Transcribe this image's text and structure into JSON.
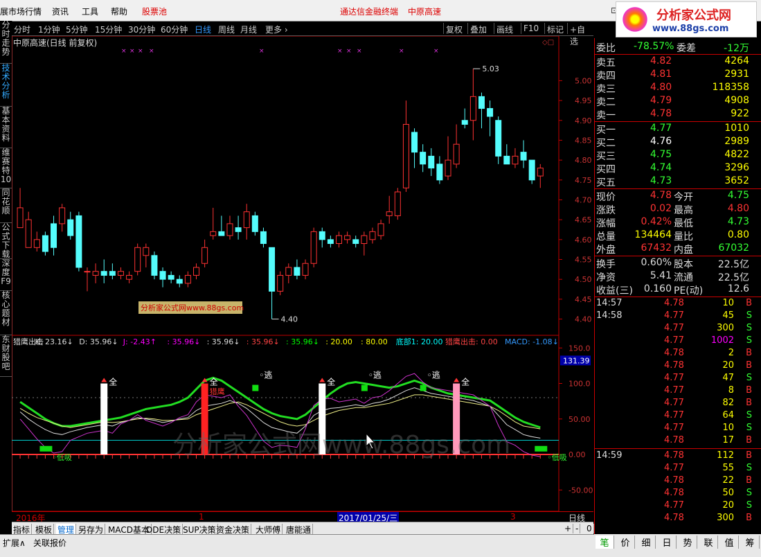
{
  "menu": {
    "items": [
      "展市场行情",
      "资讯",
      "工具",
      "帮助",
      "股票池"
    ],
    "center_title": "通达信金融终端",
    "center_stock": "中原高速"
  },
  "logo": {
    "title": "分析家公式网",
    "url": "www.88gs.com"
  },
  "left_tabs": [
    "分时走势",
    "技术分析",
    "基本资料",
    "维赛特10",
    "同花顺",
    "公式下载",
    "深度F9",
    "核心题材",
    "东财股吧"
  ],
  "timeframes": {
    "items": [
      "分时",
      "1分钟",
      "5分钟",
      "15分钟",
      "30分钟",
      "60分钟",
      "日线",
      "周线",
      "月线",
      "更多 ›"
    ],
    "selected": "日线",
    "right_items": [
      "复权",
      "叠加",
      "画线",
      "F10",
      "标记",
      "+自选"
    ]
  },
  "chart": {
    "title": "中原高速(日线 前复权)",
    "high_label": "5.03",
    "low_label": "4.40",
    "price_ticks": [
      "5.00",
      "4.95",
      "4.90",
      "4.85",
      "4.80",
      "4.75",
      "4.70",
      "4.65",
      "4.60",
      "4.55",
      "4.50",
      "4.45",
      "4.40"
    ],
    "watermark_box": "分析家公式网www.88gs.com",
    "watermark_big": "分析家公式网www.88gs.com",
    "indicator_header": [
      {
        "t": "猎鹰出击",
        "c": "#ddd"
      },
      {
        "t": "K: 23.16↓",
        "c": "#ddd"
      },
      {
        "t": "D: 35.96↓",
        "c": "#ddd"
      },
      {
        "t": "J: -2.43↑",
        "c": "#f0f"
      },
      {
        "t": ": 35.96↓",
        "c": "#f0f"
      },
      {
        "t": ": 35.96↓",
        "c": "#ddd"
      },
      {
        "t": ": 35.96↓",
        "c": "#f44"
      },
      {
        "t": ": 35.96↓",
        "c": "#0f0"
      },
      {
        "t": ": 20.00",
        "c": "#ff0"
      },
      {
        "t": ": 80.00",
        "c": "#ff0"
      },
      {
        "t": "底部1: 20.00",
        "c": "#0ff"
      }
    ],
    "indicator_header_right": {
      "a": "猎鹰出击: 0.00",
      "b": "MACD: -1.08↓"
    },
    "indicator_value_badge": "131.39",
    "ind_ticks": [
      "150.0",
      "100.0",
      "50.00",
      "0.00",
      "-50.00"
    ],
    "labels": {
      "quan": "全",
      "tao": "逃",
      "dixi": "低吸",
      "liechu": "猎鹰"
    },
    "dates": {
      "start": "2016年",
      "m1": "1",
      "current": "2017/01/25/三",
      "m3": "3",
      "period": "日线"
    }
  },
  "chart_data": {
    "type": "candlestick",
    "title": "中原高速(日线 前复权)",
    "ylim": [
      4.38,
      5.06
    ],
    "candles": [
      [
        4.63,
        4.68,
        4.66,
        4.73
      ],
      [
        4.58,
        4.65,
        4.6,
        4.67
      ],
      [
        4.58,
        4.6,
        4.57,
        4.62
      ],
      [
        4.61,
        4.57,
        4.56,
        4.62
      ],
      [
        4.64,
        4.58,
        4.56,
        4.66
      ],
      [
        4.64,
        4.68,
        4.62,
        4.69
      ],
      [
        4.65,
        4.61,
        4.6,
        4.67
      ],
      [
        4.66,
        4.53,
        4.52,
        4.67
      ],
      [
        4.52,
        4.52,
        4.47,
        4.53
      ],
      [
        4.51,
        4.52,
        4.49,
        4.54
      ],
      [
        4.52,
        4.51,
        4.49,
        4.55
      ],
      [
        4.52,
        4.51,
        4.5,
        4.54
      ],
      [
        4.51,
        4.52,
        4.5,
        4.53
      ],
      [
        4.5,
        4.51,
        4.49,
        4.52
      ],
      [
        4.52,
        4.58,
        4.51,
        4.59
      ],
      [
        4.56,
        4.58,
        4.53,
        4.59
      ],
      [
        4.56,
        4.51,
        4.5,
        4.57
      ],
      [
        4.52,
        4.5,
        4.48,
        4.53
      ],
      [
        4.51,
        4.5,
        4.49,
        4.52
      ],
      [
        4.5,
        4.49,
        4.48,
        4.51
      ],
      [
        4.49,
        4.51,
        4.48,
        4.52
      ],
      [
        4.51,
        4.53,
        4.5,
        4.54
      ],
      [
        4.54,
        4.58,
        4.53,
        4.6
      ],
      [
        4.61,
        4.62,
        4.6,
        4.68
      ],
      [
        4.62,
        4.61,
        4.61,
        4.66
      ],
      [
        4.61,
        4.64,
        4.6,
        4.66
      ],
      [
        4.63,
        4.62,
        4.6,
        4.66
      ],
      [
        4.63,
        4.67,
        4.6,
        4.69
      ],
      [
        4.66,
        4.62,
        4.61,
        4.67
      ],
      [
        4.62,
        4.59,
        4.58,
        4.63
      ],
      [
        4.58,
        4.47,
        4.4,
        4.58
      ],
      [
        4.47,
        4.51,
        4.46,
        4.52
      ],
      [
        4.51,
        4.53,
        4.49,
        4.54
      ],
      [
        4.53,
        4.51,
        4.5,
        4.55
      ],
      [
        4.51,
        4.54,
        4.5,
        4.55
      ],
      [
        4.54,
        4.62,
        4.53,
        4.63
      ],
      [
        4.62,
        4.6,
        4.58,
        4.63
      ],
      [
        4.6,
        4.59,
        4.58,
        4.61
      ],
      [
        4.59,
        4.61,
        4.58,
        4.62
      ],
      [
        4.6,
        4.61,
        4.59,
        4.62
      ],
      [
        4.6,
        4.59,
        4.58,
        4.61
      ],
      [
        4.59,
        4.61,
        4.56,
        4.62
      ],
      [
        4.6,
        4.62,
        4.59,
        4.63
      ],
      [
        4.61,
        4.64,
        4.6,
        4.65
      ],
      [
        4.66,
        4.67,
        4.64,
        4.71
      ],
      [
        4.66,
        4.72,
        4.65,
        4.73
      ],
      [
        4.73,
        4.89,
        4.72,
        4.95
      ],
      [
        4.87,
        4.82,
        4.78,
        4.88
      ],
      [
        4.82,
        4.79,
        4.77,
        4.84
      ],
      [
        4.81,
        4.78,
        4.76,
        4.83
      ],
      [
        4.79,
        4.75,
        4.74,
        4.81
      ],
      [
        4.76,
        4.8,
        4.75,
        4.86
      ],
      [
        4.79,
        4.84,
        4.78,
        4.89
      ],
      [
        4.9,
        4.89,
        4.88,
        4.93
      ],
      [
        4.9,
        4.96,
        4.85,
        5.03
      ],
      [
        4.96,
        4.93,
        4.88,
        4.97
      ],
      [
        4.93,
        4.91,
        4.86,
        4.95
      ],
      [
        4.9,
        4.81,
        4.79,
        4.91
      ],
      [
        4.81,
        4.79,
        4.79,
        4.84
      ],
      [
        4.79,
        4.81,
        4.78,
        4.83
      ],
      [
        4.82,
        4.8,
        4.78,
        4.85
      ],
      [
        4.8,
        4.75,
        4.74,
        4.8
      ],
      [
        4.76,
        4.78,
        4.73,
        4.79
      ]
    ],
    "indicator": {
      "name": "猎鹰出击",
      "ylim": [
        -80,
        160
      ],
      "signals_full": [
        10,
        22,
        36,
        52
      ],
      "signals_escape": [
        28,
        41,
        48
      ]
    }
  },
  "quote": {
    "weibi": {
      "label": "委比",
      "value": "-78.57%",
      "label2": "委差",
      "value2": "-12万"
    },
    "asks": [
      {
        "label": "卖五",
        "price": "4.82",
        "vol": "4264"
      },
      {
        "label": "卖四",
        "price": "4.81",
        "vol": "2931"
      },
      {
        "label": "卖三",
        "price": "4.80",
        "vol": "118358"
      },
      {
        "label": "卖二",
        "price": "4.79",
        "vol": "4908"
      },
      {
        "label": "卖一",
        "price": "4.78",
        "vol": "922"
      }
    ],
    "bids": [
      {
        "label": "买一",
        "price": "4.77",
        "vol": "1010",
        "pc": "#3f3"
      },
      {
        "label": "买二",
        "price": "4.76",
        "vol": "2989",
        "pc": "#fff"
      },
      {
        "label": "买三",
        "price": "4.75",
        "vol": "4822",
        "pc": "#3f3"
      },
      {
        "label": "买四",
        "price": "4.74",
        "vol": "3296",
        "pc": "#3f3"
      },
      {
        "label": "买五",
        "price": "4.73",
        "vol": "3652",
        "pc": "#3f3"
      }
    ],
    "stats": [
      {
        "l1": "现价",
        "v1": "4.78",
        "c1": "#f33",
        "l2": "今开",
        "v2": "4.75",
        "c2": "#3f3"
      },
      {
        "l1": "涨跌",
        "v1": "0.02",
        "c1": "#f33",
        "l2": "最高",
        "v2": "4.80",
        "c2": "#f33"
      },
      {
        "l1": "涨幅",
        "v1": "0.42%",
        "c1": "#f33",
        "l2": "最低",
        "v2": "4.73",
        "c2": "#3f3"
      },
      {
        "l1": "总量",
        "v1": "134464",
        "c1": "#ff0",
        "l2": "量比",
        "v2": "0.80",
        "c2": "#ff0"
      },
      {
        "l1": "外盘",
        "v1": "67432",
        "c1": "#f33",
        "l2": "内盘",
        "v2": "67032",
        "c2": "#3f3"
      }
    ],
    "stats2": [
      {
        "l1": "换手",
        "v1": "0.60%",
        "l2": "股本",
        "v2": "22.5亿"
      },
      {
        "l1": "净资",
        "v1": "5.41",
        "l2": "流通",
        "v2": "22.5亿"
      },
      {
        "l1": "收益(三)",
        "v1": "0.160",
        "l2": "PE(动)",
        "v2": "12.6"
      }
    ],
    "ticks": [
      {
        "time": "14:57",
        "price": "4.78",
        "vol": "10",
        "bs": "B"
      },
      {
        "time": "14:58",
        "price": "4.77",
        "vol": "45",
        "bs": "S"
      },
      {
        "time": "",
        "price": "4.77",
        "vol": "300",
        "bs": "S"
      },
      {
        "time": "",
        "price": "4.77",
        "vol": "1002",
        "bs": "S"
      },
      {
        "time": "",
        "price": "4.78",
        "vol": "2",
        "bs": "B"
      },
      {
        "time": "",
        "price": "4.78",
        "vol": "20",
        "bs": "B"
      },
      {
        "time": "",
        "price": "4.77",
        "vol": "47",
        "bs": "S"
      },
      {
        "time": "",
        "price": "4.77",
        "vol": "8",
        "bs": "B"
      },
      {
        "time": "",
        "price": "4.77",
        "vol": "82",
        "bs": "B"
      },
      {
        "time": "",
        "price": "4.77",
        "vol": "64",
        "bs": "S"
      },
      {
        "time": "",
        "price": "4.77",
        "vol": "10",
        "bs": "S"
      },
      {
        "time": "",
        "price": "4.78",
        "vol": "17",
        "bs": "B"
      },
      {
        "time": "14:59",
        "price": "4.78",
        "vol": "112",
        "bs": "B"
      },
      {
        "time": "",
        "price": "4.77",
        "vol": "55",
        "bs": "S"
      },
      {
        "time": "",
        "price": "4.78",
        "vol": "22",
        "bs": "B"
      },
      {
        "time": "",
        "price": "4.78",
        "vol": "50",
        "bs": "S"
      },
      {
        "time": "",
        "price": "4.77",
        "vol": "20",
        "bs": "S"
      },
      {
        "time": "",
        "price": "4.78",
        "vol": "300",
        "bs": "B"
      }
    ]
  },
  "bottom_tabs": [
    "指标",
    "模板",
    "管理",
    "另存为",
    "MACD基本",
    "DDE决策",
    "SUP决策",
    "资金决策",
    "大师傅",
    "唐能通"
  ],
  "bottom_selected": "管理",
  "bottom_right": [
    "+",
    "-",
    "0"
  ],
  "status": {
    "left": "扩展∧",
    "right": "关联报价"
  },
  "right_tabs": [
    "笔",
    "价",
    "细",
    "日",
    "势",
    "联",
    "值",
    "筹"
  ],
  "colors": {
    "up": "#ff3232",
    "down": "#54fcfc",
    "bg": "#000000",
    "grid": "#c00000"
  }
}
